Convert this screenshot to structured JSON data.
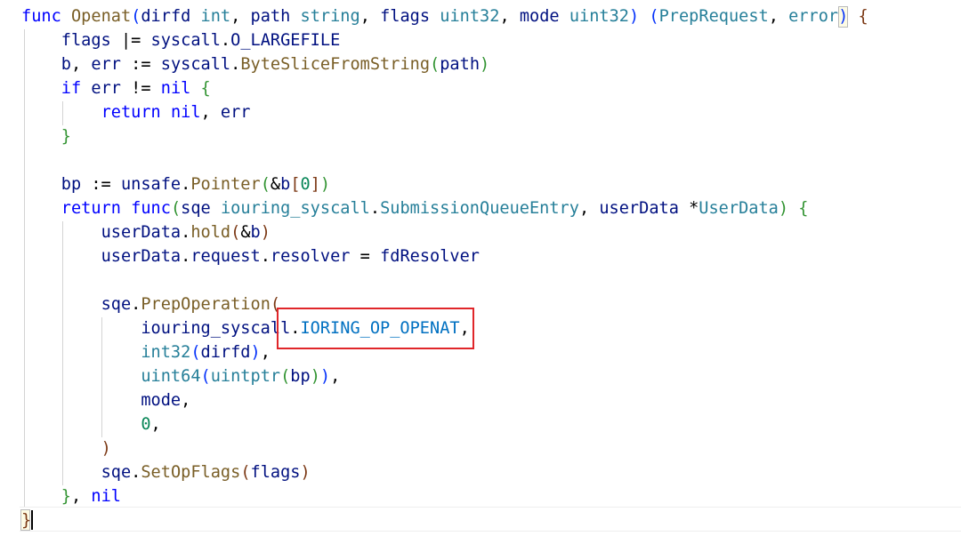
{
  "editor": {
    "lines": [
      [
        {
          "t": "func",
          "c": "k"
        },
        {
          "t": " "
        },
        {
          "t": "Openat",
          "c": "f"
        },
        {
          "t": "(",
          "c": "b1"
        },
        {
          "t": "dirfd",
          "c": "v"
        },
        {
          "t": " "
        },
        {
          "t": "int",
          "c": "t"
        },
        {
          "t": ", ",
          "c": "p"
        },
        {
          "t": "path",
          "c": "v"
        },
        {
          "t": " "
        },
        {
          "t": "string",
          "c": "t"
        },
        {
          "t": ", ",
          "c": "p"
        },
        {
          "t": "flags",
          "c": "v"
        },
        {
          "t": " "
        },
        {
          "t": "uint32",
          "c": "t"
        },
        {
          "t": ", ",
          "c": "p"
        },
        {
          "t": "mode",
          "c": "v"
        },
        {
          "t": " "
        },
        {
          "t": "uint32",
          "c": "t"
        },
        {
          "t": ")",
          "c": "b1"
        },
        {
          "t": " "
        },
        {
          "t": "(",
          "c": "b1"
        },
        {
          "t": "PrepRequest",
          "c": "t"
        },
        {
          "t": ", ",
          "c": "p"
        },
        {
          "t": "error",
          "c": "t"
        },
        {
          "t": ")",
          "c": "b1"
        },
        {
          "t": " "
        },
        {
          "t": "{",
          "c": "b3"
        }
      ],
      [
        {
          "t": "    "
        },
        {
          "t": "flags",
          "c": "v"
        },
        {
          "t": " |= ",
          "c": "p"
        },
        {
          "t": "syscall",
          "c": "v"
        },
        {
          "t": ".",
          "c": "p"
        },
        {
          "t": "O_LARGEFILE",
          "c": "v"
        }
      ],
      [
        {
          "t": "    "
        },
        {
          "t": "b",
          "c": "v"
        },
        {
          "t": ", ",
          "c": "p"
        },
        {
          "t": "err",
          "c": "v"
        },
        {
          "t": " := ",
          "c": "p"
        },
        {
          "t": "syscall",
          "c": "v"
        },
        {
          "t": ".",
          "c": "p"
        },
        {
          "t": "ByteSliceFromString",
          "c": "f"
        },
        {
          "t": "(",
          "c": "b2"
        },
        {
          "t": "path",
          "c": "v"
        },
        {
          "t": ")",
          "c": "b2"
        }
      ],
      [
        {
          "t": "    "
        },
        {
          "t": "if",
          "c": "k"
        },
        {
          "t": " "
        },
        {
          "t": "err",
          "c": "v"
        },
        {
          "t": " != ",
          "c": "p"
        },
        {
          "t": "nil",
          "c": "k"
        },
        {
          "t": " "
        },
        {
          "t": "{",
          "c": "b2"
        }
      ],
      [
        {
          "t": "        "
        },
        {
          "t": "return",
          "c": "k"
        },
        {
          "t": " "
        },
        {
          "t": "nil",
          "c": "k"
        },
        {
          "t": ", ",
          "c": "p"
        },
        {
          "t": "err",
          "c": "v"
        }
      ],
      [
        {
          "t": "    "
        },
        {
          "t": "}",
          "c": "b2"
        }
      ],
      [],
      [
        {
          "t": "    "
        },
        {
          "t": "bp",
          "c": "v"
        },
        {
          "t": " := ",
          "c": "p"
        },
        {
          "t": "unsafe",
          "c": "v"
        },
        {
          "t": ".",
          "c": "p"
        },
        {
          "t": "Pointer",
          "c": "f"
        },
        {
          "t": "(",
          "c": "b2"
        },
        {
          "t": "&",
          "c": "p"
        },
        {
          "t": "b",
          "c": "v"
        },
        {
          "t": "[",
          "c": "b3"
        },
        {
          "t": "0",
          "c": "n"
        },
        {
          "t": "]",
          "c": "b3"
        },
        {
          "t": ")",
          "c": "b2"
        }
      ],
      [
        {
          "t": "    "
        },
        {
          "t": "return",
          "c": "k"
        },
        {
          "t": " "
        },
        {
          "t": "func",
          "c": "k"
        },
        {
          "t": "(",
          "c": "b2"
        },
        {
          "t": "sqe",
          "c": "v"
        },
        {
          "t": " "
        },
        {
          "t": "iouring_syscall",
          "c": "t"
        },
        {
          "t": ".",
          "c": "p"
        },
        {
          "t": "SubmissionQueueEntry",
          "c": "t"
        },
        {
          "t": ", ",
          "c": "p"
        },
        {
          "t": "userData",
          "c": "v"
        },
        {
          "t": " *",
          "c": "p"
        },
        {
          "t": "UserData",
          "c": "t"
        },
        {
          "t": ")",
          "c": "b2"
        },
        {
          "t": " "
        },
        {
          "t": "{",
          "c": "b2"
        }
      ],
      [
        {
          "t": "        "
        },
        {
          "t": "userData",
          "c": "v"
        },
        {
          "t": ".",
          "c": "p"
        },
        {
          "t": "hold",
          "c": "f"
        },
        {
          "t": "(",
          "c": "b3"
        },
        {
          "t": "&",
          "c": "p"
        },
        {
          "t": "b",
          "c": "v"
        },
        {
          "t": ")",
          "c": "b3"
        }
      ],
      [
        {
          "t": "        "
        },
        {
          "t": "userData",
          "c": "v"
        },
        {
          "t": ".",
          "c": "p"
        },
        {
          "t": "request",
          "c": "v"
        },
        {
          "t": ".",
          "c": "p"
        },
        {
          "t": "resolver",
          "c": "v"
        },
        {
          "t": " = ",
          "c": "p"
        },
        {
          "t": "fdResolver",
          "c": "v"
        }
      ],
      [],
      [
        {
          "t": "        "
        },
        {
          "t": "sqe",
          "c": "v"
        },
        {
          "t": ".",
          "c": "p"
        },
        {
          "t": "PrepOperation",
          "c": "f"
        },
        {
          "t": "(",
          "c": "b3"
        }
      ],
      [
        {
          "t": "            "
        },
        {
          "t": "iouring_syscall",
          "c": "v"
        },
        {
          "t": ".",
          "c": "p"
        },
        {
          "t": "IORING_OP_OPENAT",
          "c": "c"
        },
        {
          "t": ",",
          "c": "p"
        }
      ],
      [
        {
          "t": "            "
        },
        {
          "t": "int32",
          "c": "t"
        },
        {
          "t": "(",
          "c": "b1"
        },
        {
          "t": "dirfd",
          "c": "v"
        },
        {
          "t": ")",
          "c": "b1"
        },
        {
          "t": ",",
          "c": "p"
        }
      ],
      [
        {
          "t": "            "
        },
        {
          "t": "uint64",
          "c": "t"
        },
        {
          "t": "(",
          "c": "b1"
        },
        {
          "t": "uintptr",
          "c": "t"
        },
        {
          "t": "(",
          "c": "b2"
        },
        {
          "t": "bp",
          "c": "v"
        },
        {
          "t": ")",
          "c": "b2"
        },
        {
          "t": ")",
          "c": "b1"
        },
        {
          "t": ",",
          "c": "p"
        }
      ],
      [
        {
          "t": "            "
        },
        {
          "t": "mode",
          "c": "v"
        },
        {
          "t": ",",
          "c": "p"
        }
      ],
      [
        {
          "t": "            "
        },
        {
          "t": "0",
          "c": "n"
        },
        {
          "t": ",",
          "c": "p"
        }
      ],
      [
        {
          "t": "        "
        },
        {
          "t": ")",
          "c": "b3"
        }
      ],
      [
        {
          "t": "        "
        },
        {
          "t": "sqe",
          "c": "v"
        },
        {
          "t": ".",
          "c": "p"
        },
        {
          "t": "SetOpFlags",
          "c": "f"
        },
        {
          "t": "(",
          "c": "b3"
        },
        {
          "t": "flags",
          "c": "v"
        },
        {
          "t": ")",
          "c": "b3"
        }
      ],
      [
        {
          "t": "    "
        },
        {
          "t": "}",
          "c": "b2"
        },
        {
          "t": ", ",
          "c": "p"
        },
        {
          "t": "nil",
          "c": "k"
        }
      ],
      [
        {
          "t": "}",
          "c": "b3"
        }
      ]
    ]
  },
  "colors": {
    "keyword": "#0000ff",
    "function": "#795e26",
    "type": "#267f99",
    "variable": "#001080",
    "number": "#098658",
    "constant": "#0070c1",
    "bracket_1": "#0431fa",
    "bracket_2": "#319331",
    "bracket_3": "#7b3814",
    "highlight_box": "#e0262a"
  }
}
